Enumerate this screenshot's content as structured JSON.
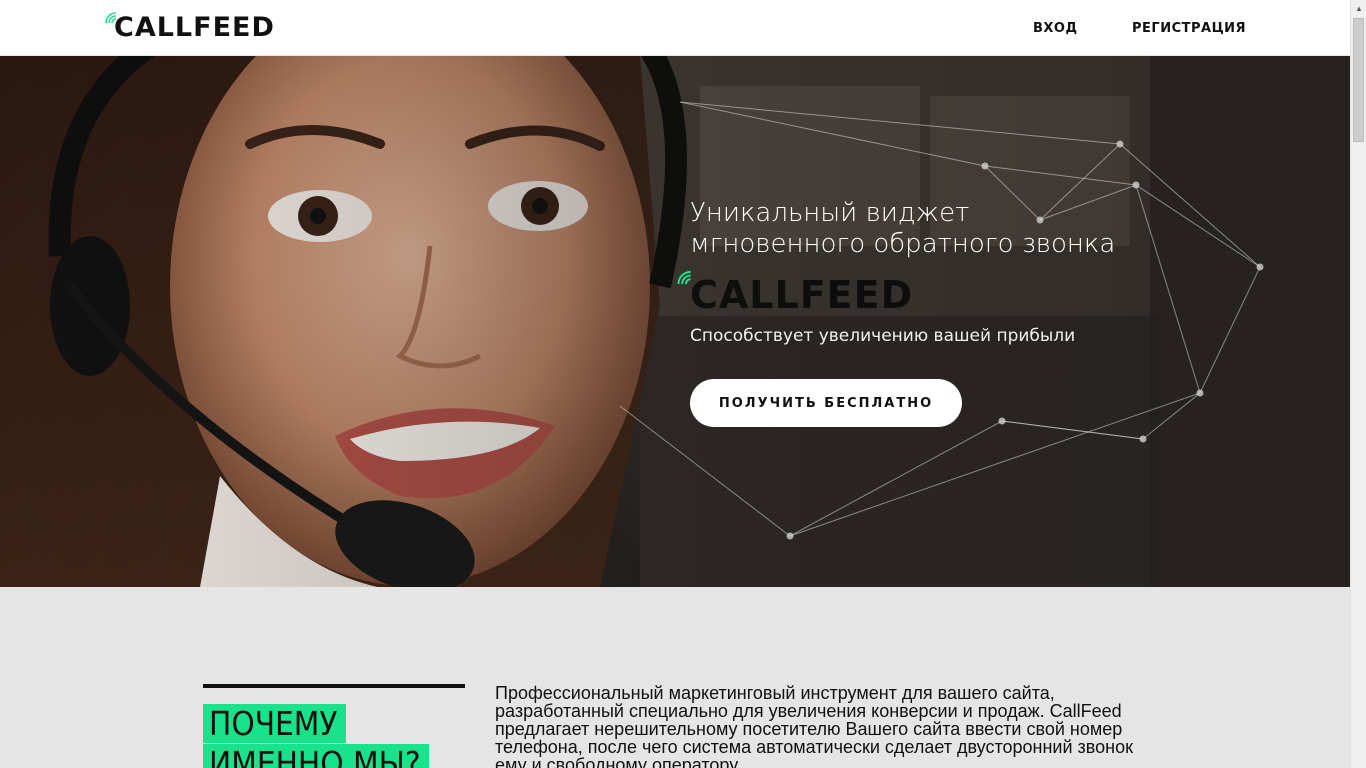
{
  "header": {
    "logo": "CALLFEED",
    "nav": {
      "login": "ВХОД",
      "register": "РЕГИСТРАЦИЯ"
    }
  },
  "hero": {
    "title_line1": "Уникальный виджет",
    "title_line2": "мгновенного обратного звонка",
    "logo": "CALLFEED",
    "subtitle": "Способствует увеличению вашей прибыли",
    "cta": "ПОЛУЧИТЬ БЕСПЛАТНО"
  },
  "about": {
    "heading_line1": "ПОЧЕМУ",
    "heading_line2": "ИМЕННО МЫ?",
    "text": "Профессиональный маркетинговый инструмент для вашего сайта, разработанный специально для увеличения конверсии и продаж. CallFeed предлагает нерешительному посетителю Вашего сайта ввести свой номер телефона, после чего система автоматически сделает двусторонний звонок ему и свободному оператору."
  },
  "colors": {
    "accent": "#19e38a",
    "lower_bg": "#e5e5e5",
    "text": "#111111"
  },
  "icons": {
    "logo_icon": "signal-wave-icon",
    "hero_image": "operator-with-headset-photo"
  }
}
